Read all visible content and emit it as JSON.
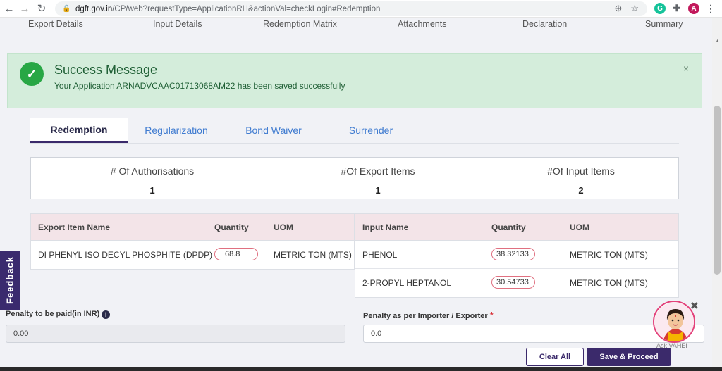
{
  "browser": {
    "url_host": "dgft.gov.in",
    "url_path": "/CP/web?requestType=ApplicationRH&actionVal=checkLogin#Redemption",
    "profile_initial": "A"
  },
  "steps": [
    "Export Details",
    "Input Details",
    "Redemption Matrix",
    "Attachments",
    "Declaration",
    "Summary"
  ],
  "alert": {
    "title": "Success Message",
    "message": "Your Application ARNADVCAAC01713068AM22 has been saved successfully",
    "close": "×"
  },
  "tabs": [
    "Redemption",
    "Regularization",
    "Bond Waiver",
    "Surrender"
  ],
  "stats": [
    {
      "label": "# Of Authorisations",
      "value": "1"
    },
    {
      "label": "#Of Export Items",
      "value": "1"
    },
    {
      "label": "#Of Input Items",
      "value": "2"
    }
  ],
  "export_table": {
    "headers": [
      "Export Item Name",
      "Quantity",
      "UOM"
    ],
    "rows": [
      {
        "name": "DI PHENYL ISO DECYL PHOSPHITE (DPDP)",
        "quantity": "68.8",
        "uom": "METRIC TON (MTS)"
      }
    ]
  },
  "input_table": {
    "headers": [
      "Input Name",
      "Quantity",
      "UOM"
    ],
    "rows": [
      {
        "name": "PHENOL",
        "quantity": "38.32133",
        "uom": "METRIC TON (MTS)"
      },
      {
        "name": "2-PROPYL HEPTANOL",
        "quantity": "30.54733",
        "uom": "METRIC TON (MTS)"
      }
    ]
  },
  "feedback": "Feedback",
  "penalty": {
    "left_label": "Penalty to be paid(in INR)",
    "left_value": "0.00",
    "right_label": "Penalty as per Importer / Exporter",
    "right_required": "*",
    "right_value": "0.0"
  },
  "buttons": {
    "clear": "Clear All",
    "save": "Save & Proceed"
  },
  "assistant": {
    "label": "Ask VAHEI"
  },
  "colors": {
    "success_bg": "#d4eddb",
    "success_icon": "#28a745",
    "brand": "#3b2a6b",
    "header_row": "#f3e4e8"
  }
}
